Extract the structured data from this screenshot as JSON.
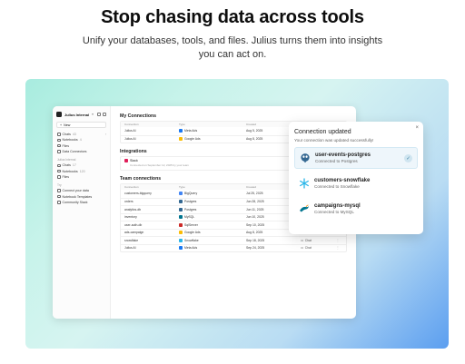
{
  "hero": {
    "title": "Stop chasing data across tools",
    "subtitle": "Unify your databases, tools, and files. Julius turns them into insights you can act on."
  },
  "sidebar": {
    "workspace": "Julius Internal",
    "new_label": "New",
    "items": [
      {
        "label": "Chats",
        "count": "43",
        "icon": "chat-icon"
      },
      {
        "label": "Notebooks",
        "count": "4",
        "icon": "notebook-icon"
      },
      {
        "label": "Files",
        "count": "",
        "icon": "file-icon"
      },
      {
        "label": "Data Connectors",
        "count": "",
        "icon": "connector-icon"
      }
    ],
    "section_team": "Julius Internal",
    "team_items": [
      {
        "label": "Chats",
        "count": "17"
      },
      {
        "label": "Notebooks",
        "count": "120"
      },
      {
        "label": "Files",
        "count": ""
      }
    ],
    "section_try": "Try",
    "try_items": [
      {
        "label": "Connect your data"
      },
      {
        "label": "Notebook Templates"
      },
      {
        "label": "Community Slack"
      }
    ]
  },
  "my_connections": {
    "title": "My Connections",
    "headers": [
      "Connection",
      "Type",
      "Created"
    ],
    "rows": [
      {
        "name": "Julius AI",
        "type": "Meta Ads",
        "created": "Aug 5, 2025",
        "color": "#1877f2"
      },
      {
        "name": "Julius AI",
        "type": "Google Ads",
        "created": "Aug 8, 2025",
        "color": "#fbbc04"
      }
    ]
  },
  "integrations": {
    "title": "Integrations",
    "name": "Slack",
    "desc": "Connected on September 12, 2025 by your team"
  },
  "team_connections": {
    "title": "Team connections",
    "headers": [
      "Connection",
      "Type",
      "Created"
    ],
    "chat_label": "Chat",
    "rows": [
      {
        "name": "customers-bigquery",
        "type": "BigQuery",
        "created": "Jul 25, 2025",
        "color": "#4285f4"
      },
      {
        "name": "orders",
        "type": "Postgres",
        "created": "Jun 28, 2025",
        "color": "#336791"
      },
      {
        "name": "analytics-db",
        "type": "Postgres",
        "created": "Jun 11, 2025",
        "color": "#336791"
      },
      {
        "name": "inventory",
        "type": "MySQL",
        "created": "Jun 10, 2025",
        "color": "#00758f"
      },
      {
        "name": "user-auth-db",
        "type": "SqlServer",
        "created": "Sep 10, 2025",
        "color": "#cc2927"
      },
      {
        "name": "ads-campaign",
        "type": "Google Ads",
        "created": "Aug 8, 2025",
        "color": "#fbbc04"
      },
      {
        "name": "snowflake",
        "type": "Snowflake",
        "created": "Sep 18, 2025",
        "color": "#29b5e8"
      },
      {
        "name": "Julius AI",
        "type": "Meta Ads",
        "created": "Sep 24, 2025",
        "color": "#1877f2"
      }
    ]
  },
  "panel": {
    "title": "Connection updated",
    "subtitle": "Your connection was updated successfully!",
    "close": "×",
    "items": [
      {
        "name": "user-events-postgres",
        "status": "Connected to Postgres",
        "selected": true
      },
      {
        "name": "customers-snowflake",
        "status": "Connected to Snowflake",
        "selected": false
      },
      {
        "name": "campaigns-mysql",
        "status": "Connected to MySQL",
        "selected": false
      }
    ]
  },
  "icons": {
    "postgres": "postgres-elephant-icon",
    "snowflake": "snowflake-icon",
    "mysql": "mysql-dolphin-icon",
    "check": "check-icon",
    "close": "close-icon"
  },
  "colors": {
    "postgres": "#336791",
    "snowflake": "#29b5e8",
    "mysql": "#00758f",
    "check": "#3a7ea0",
    "selected_bg": "#eef6fb"
  }
}
